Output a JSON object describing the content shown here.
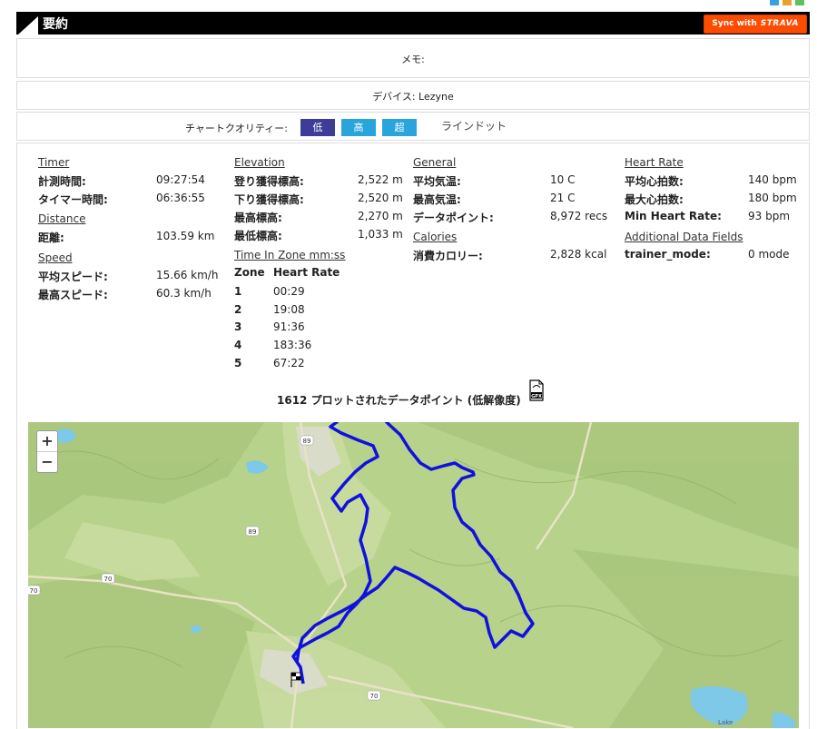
{
  "header": {
    "title": "要約",
    "strava": {
      "prefix": "Sync with",
      "brand": "STRAVA"
    }
  },
  "memo": "メモ:",
  "device": "デバイス: Lezyne",
  "quality": {
    "label": "チャートクオリティー:",
    "buttons": [
      "低",
      "高",
      "超"
    ],
    "extra": "ラインドット"
  },
  "stats": {
    "timer": {
      "heading": "Timer",
      "rows": [
        [
          "計測時間:",
          "09:27:54"
        ],
        [
          "タイマー時間:",
          "06:36:55"
        ]
      ]
    },
    "distance": {
      "heading": "Distance",
      "rows": [
        [
          "距離:",
          "103.59 km"
        ]
      ]
    },
    "speed": {
      "heading": "Speed",
      "rows": [
        [
          "平均スピード:",
          "15.66 km/h"
        ],
        [
          "最高スピード:",
          "60.3 km/h"
        ]
      ]
    },
    "elevation": {
      "heading": "Elevation",
      "rows": [
        [
          "登り獲得標高:",
          "2,522 m"
        ],
        [
          "下り獲得標高:",
          "2,520 m"
        ],
        [
          "最高標高:",
          "2,270 m"
        ],
        [
          "最低標高:",
          "1,033 m"
        ]
      ]
    },
    "zones": {
      "heading": "Time In Zone mm:ss",
      "col1": "Zone",
      "col2": "Heart Rate",
      "rows": [
        [
          "1",
          "00:29"
        ],
        [
          "2",
          "19:08"
        ],
        [
          "3",
          "91:36"
        ],
        [
          "4",
          "183:36"
        ],
        [
          "5",
          "67:22"
        ]
      ]
    },
    "general": {
      "heading": "General",
      "rows": [
        [
          "平均気温:",
          "10 C"
        ],
        [
          "最高気温:",
          "21 C"
        ],
        [
          "データポイント:",
          "8,972 recs"
        ]
      ]
    },
    "calories": {
      "heading": "Calories",
      "rows": [
        [
          "消費カロリー:",
          "2,828 kcal"
        ]
      ]
    },
    "heart": {
      "heading": "Heart Rate",
      "rows": [
        [
          "平均心拍数:",
          "140 bpm"
        ],
        [
          "最大心拍数:",
          "180 bpm"
        ],
        [
          "Min Heart Rate:",
          "93 bpm"
        ]
      ]
    },
    "additional": {
      "heading": "Additional Data Fields",
      "rows": [
        [
          "trainer_mode:",
          "0 mode"
        ]
      ]
    }
  },
  "plot_caption": "1612 プロットされたデータポイント (低解像度)",
  "gpx_icon": "gpx-file-icon",
  "map": {
    "zoom_in": "+",
    "zoom_out": "−",
    "road_labels": [
      "89",
      "89",
      "70",
      "70",
      "70"
    ],
    "lake_label": "Lake",
    "route_color": "#1010e0",
    "terrain_color": "#b7d28a"
  }
}
